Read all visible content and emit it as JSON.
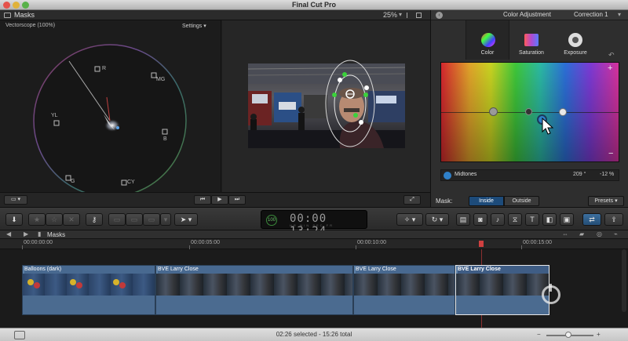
{
  "app": {
    "title": "Final Cut Pro"
  },
  "viewer_bar": {
    "project_name": "Masks",
    "zoom": "25%"
  },
  "scope": {
    "title": "Vectorscope (100%)",
    "settings_label": "Settings",
    "targets": [
      {
        "label": "R"
      },
      {
        "label": "MG"
      },
      {
        "label": "B"
      },
      {
        "label": "CY"
      },
      {
        "label": "G"
      },
      {
        "label": "YL"
      }
    ]
  },
  "inspector": {
    "title": "Color Adjustment",
    "correction": "Correction 1",
    "tabs": [
      {
        "label": "Color",
        "active": true
      },
      {
        "label": "Saturation",
        "active": false
      },
      {
        "label": "Exposure",
        "active": false
      }
    ],
    "board": {
      "plus": "+",
      "minus": "−"
    },
    "readout": {
      "label": "Midtones",
      "angle": "209 °",
      "percent": "-12 %"
    },
    "mask": {
      "label": "Mask:",
      "inside": "Inside",
      "outside": "Outside",
      "selected": "Inside"
    },
    "presets_label": "Presets"
  },
  "toolbar": {
    "timecode": "00:00 13:24",
    "timecode_badge": "100",
    "timecode_labels": "HR MIN SEC FR"
  },
  "timeline": {
    "name": "Masks",
    "ruler": [
      "00:00:00:00",
      "00:00:05:00",
      "00:00:10:00",
      "00:00:15:00"
    ],
    "clips": [
      {
        "label": "Balloons (dark)",
        "selected": false
      },
      {
        "label": "BVE Larry Close",
        "selected": false
      },
      {
        "label": "BVE Larry Close",
        "selected": false
      },
      {
        "label": "BVE Larry Close",
        "selected": true
      }
    ]
  },
  "status": {
    "text": "02:26 selected - 15:26 total"
  },
  "colors": {
    "accent_blue": "#2f80c9",
    "selected_button": "#1d4b7a",
    "clip_blue": "#5b7fa6"
  }
}
